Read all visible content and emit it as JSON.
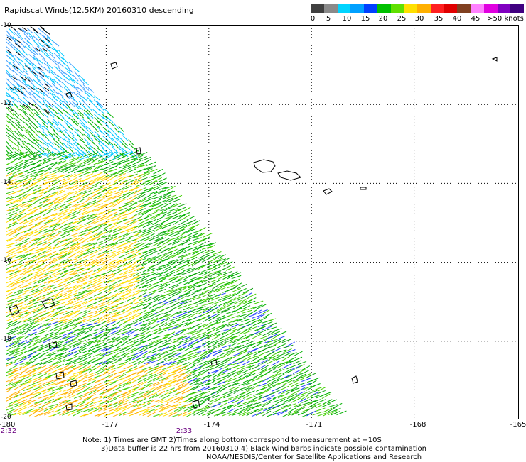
{
  "title": "Rapidscat Winds(12.5KM) 20160310 descending",
  "legend": {
    "colors": [
      "#404040",
      "#8a8a8a",
      "#00d4ff",
      "#00a0ff",
      "#0040ff",
      "#00c000",
      "#60e000",
      "#ffe000",
      "#ffb000",
      "#ff2020",
      "#e00000",
      "#804020",
      "#ff80ff",
      "#e000e0",
      "#8000c0",
      "#400080"
    ],
    "tick_labels": [
      "0",
      "5",
      "10",
      "15",
      "20",
      "25",
      "30",
      "35",
      "40",
      "45",
      ">50 knots"
    ]
  },
  "map": {
    "lat_labels": [
      "-10",
      "-12",
      "-14",
      "-16",
      "-18",
      "-20"
    ],
    "lon_labels": [
      "-180",
      "-177",
      "-174",
      "-171",
      "-168",
      "-165"
    ],
    "time_labels": [
      "2:32",
      "2:33"
    ],
    "lon_range": [
      -180,
      -165
    ],
    "lat_range": [
      -20,
      -10
    ]
  },
  "notes": {
    "line1": "Note: 1) Times are GMT 2)Times along bottom correspond to measurement at −10S",
    "line2": "3)Data buffer is 22 hrs from 20160310 4) Black wind barbs indicate possible contamination",
    "line3": "NOAA/NESDIS/Center for Satellite Applications and Research"
  }
}
